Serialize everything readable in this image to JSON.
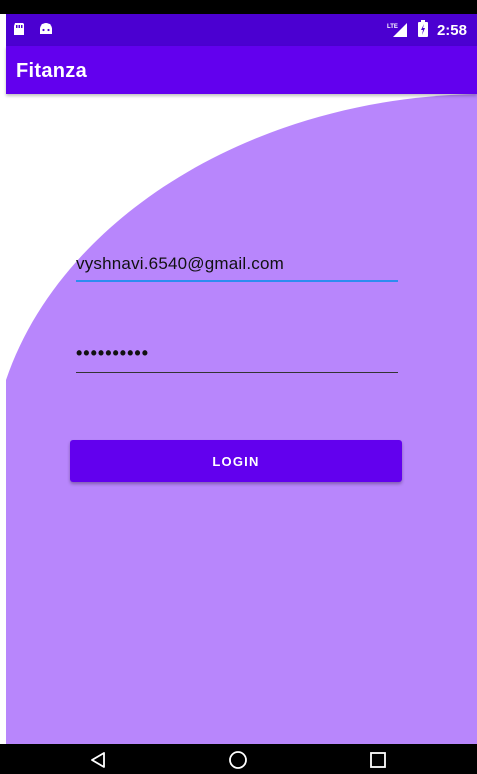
{
  "status_bar": {
    "time": "2:58",
    "network_label": "LTE",
    "left_icons": [
      "sd-card-icon",
      "android-icon"
    ],
    "right_icons": [
      "signal-icon",
      "battery-icon"
    ]
  },
  "app_bar": {
    "title": "Fitanza"
  },
  "login_form": {
    "email_value": "vyshnavi.6540@gmail.com",
    "password_value": "••••••••••",
    "login_label": "LOGIN"
  },
  "nav_bar": {
    "buttons": [
      "back-icon",
      "home-icon",
      "recents-icon"
    ]
  },
  "colors": {
    "primary": "#6200ee",
    "primary_dark": "#4b00d1",
    "background_shape": "#b886fc",
    "accent": "#2d8cf0"
  }
}
